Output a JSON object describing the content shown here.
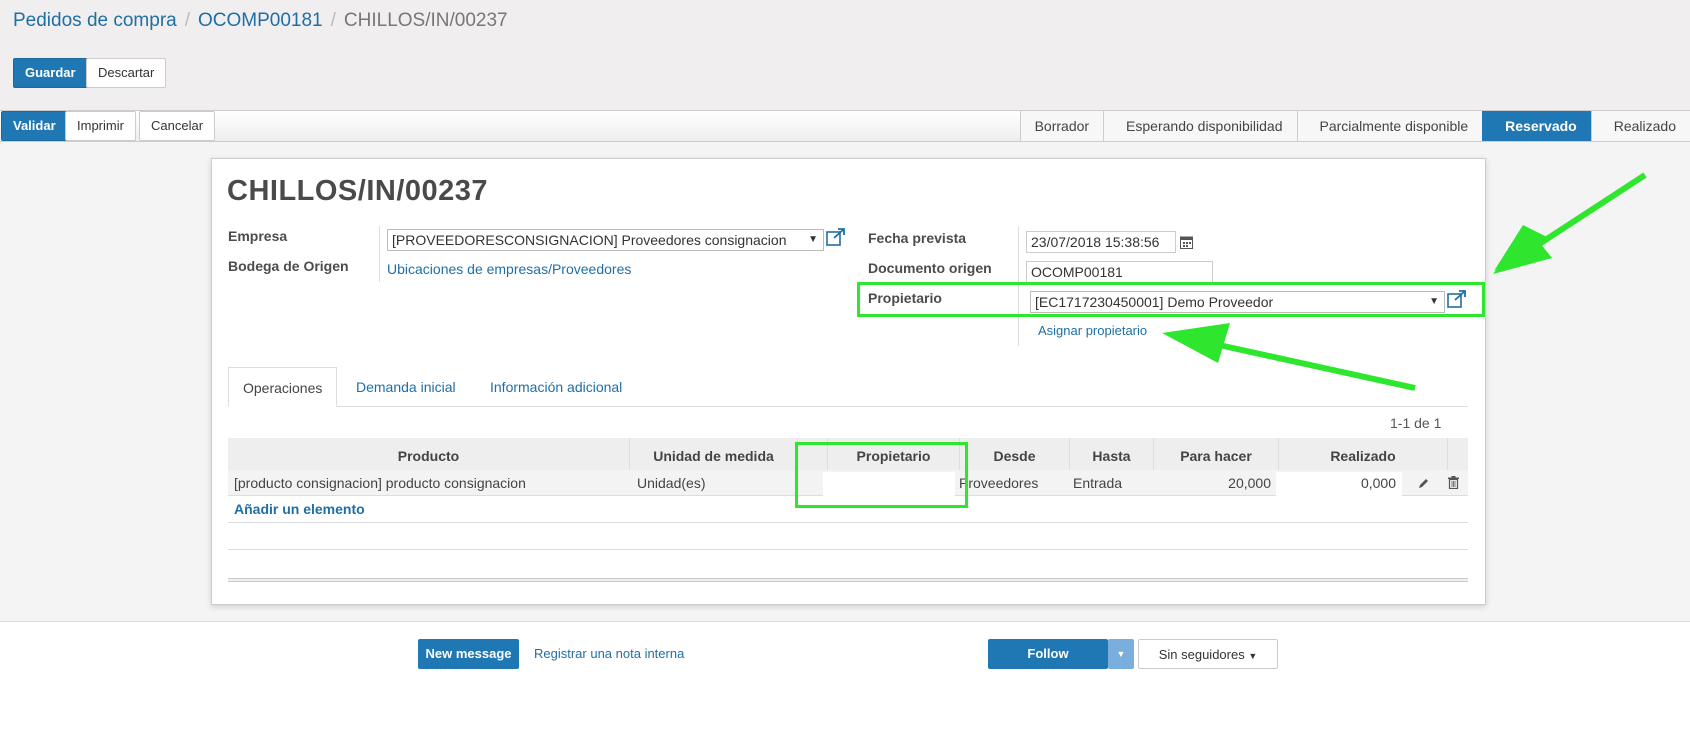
{
  "breadcrumb": {
    "root": "Pedidos de compra",
    "parent": "OCOMP00181",
    "current": "CHILLOS/IN/00237"
  },
  "buttons": {
    "save": "Guardar",
    "discard": "Descartar",
    "validate": "Validar",
    "print": "Imprimir",
    "cancel": "Cancelar"
  },
  "stages": [
    "Borrador",
    "Esperando disponibilidad",
    "Parcialmente disponible",
    "Reservado",
    "Realizado"
  ],
  "active_stage": "Reservado",
  "form": {
    "title": "CHILLOS/IN/00237",
    "empresa_label": "Empresa",
    "empresa_value": "[PROVEEDORESCONSIGNACION] Proveedores consignacion",
    "bodega_label": "Bodega de Origen",
    "bodega_value": "Ubicaciones de empresas/Proveedores",
    "fecha_label": "Fecha prevista",
    "fecha_value": "23/07/2018 15:38:56",
    "documento_label": "Documento origen",
    "documento_value": "OCOMP00181",
    "propietario_label": "Propietario",
    "propietario_value": "[EC1717230450001] Demo Proveedor",
    "asignar_link": "Asignar propietario"
  },
  "tabs": [
    "Operaciones",
    "Demanda inicial",
    "Información adicional"
  ],
  "pager": "1-1 de 1",
  "table": {
    "headers": [
      "Producto",
      "Unidad de medida",
      "Propietario",
      "Desde",
      "Hasta",
      "Para hacer",
      "Realizado"
    ],
    "rows": [
      {
        "producto": "[producto consignacion] producto consignacion",
        "unidad": "Unidad(es)",
        "propietario": "",
        "desde": "Proveedores",
        "hasta": "Entrada",
        "para_hacer": "20,000",
        "realizado": "0,000"
      }
    ],
    "add_line": "Añadir un elemento"
  },
  "chatter": {
    "new_message": "New message",
    "log_note": "Registrar una nota interna",
    "follow": "Follow",
    "followers": "Sin seguidores"
  },
  "colors": {
    "primary": "#1f78b4",
    "link": "#1f6fa5",
    "highlight": "#2ee62e"
  }
}
